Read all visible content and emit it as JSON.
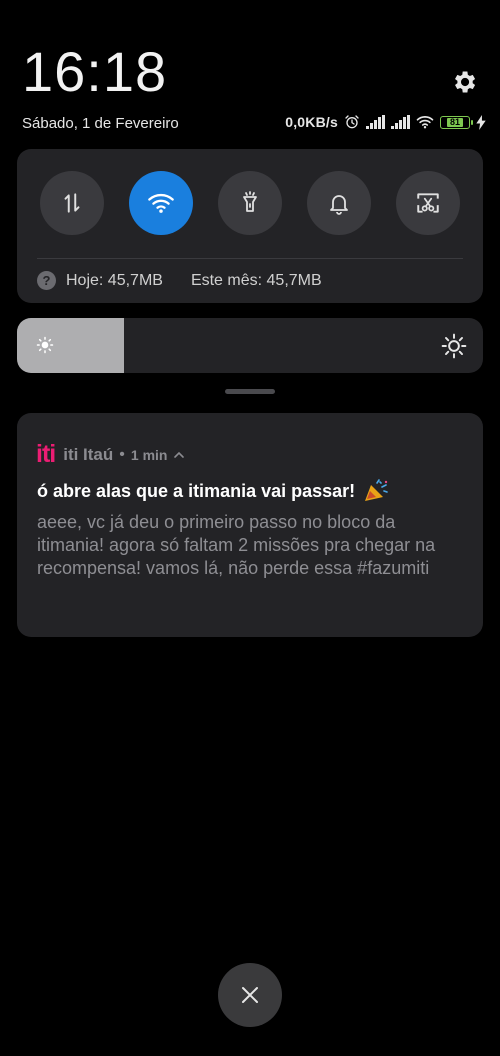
{
  "status_bar": {
    "time": "16:18",
    "date": "Sábado, 1 de Fevereiro",
    "network_speed": "0,0KB/s",
    "battery_level": "81",
    "icons": [
      "alarm-icon",
      "signal-icon",
      "signal-icon",
      "wifi-icon",
      "battery-icon",
      "charging-icon"
    ]
  },
  "quick_settings": {
    "toggles": [
      {
        "name": "mobile-data",
        "icon": "data-arrows-icon",
        "active": false
      },
      {
        "name": "wifi",
        "icon": "wifi-icon",
        "active": true
      },
      {
        "name": "flashlight",
        "icon": "flashlight-icon",
        "active": false
      },
      {
        "name": "sound",
        "icon": "bell-icon",
        "active": false
      },
      {
        "name": "screenshot",
        "icon": "scissors-icon",
        "active": false
      }
    ],
    "data_usage": {
      "today": "Hoje: 45,7MB",
      "month": "Este mês: 45,7MB"
    },
    "accent_color": "#1a7fde"
  },
  "brightness": {
    "level": 0.23
  },
  "notification": {
    "app_logo": "iti",
    "app_name": "iti Itaú",
    "separator": "•",
    "time": "1 min",
    "title": "ó abre alas que a itimania vai passar!",
    "body": "aeee, vc já deu o primeiro passo no bloco da itimania! agora só faltam 2 missões pra chegar na recompensa! vamos lá, não perde essa #fazumiti",
    "brand_color": "#ec1d73"
  }
}
